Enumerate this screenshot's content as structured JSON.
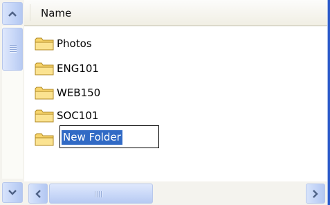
{
  "header": {
    "name_column": "Name"
  },
  "files": [
    {
      "label": "Photos",
      "icon": "folder-icon"
    },
    {
      "label": "ENG101",
      "icon": "folder-icon"
    },
    {
      "label": "WEB150",
      "icon": "folder-icon"
    },
    {
      "label": "SOC101",
      "icon": "folder-icon"
    }
  ],
  "rename": {
    "value": "New Folder",
    "icon": "folder-icon"
  },
  "scrollbars": {
    "up_glyph": "^",
    "down_glyph": "v",
    "left_glyph": "<",
    "right_glyph": ">"
  },
  "colors": {
    "selection": "#316ac5",
    "folder": "#f7d46b",
    "scroll_accent": "#c3d4f7"
  }
}
